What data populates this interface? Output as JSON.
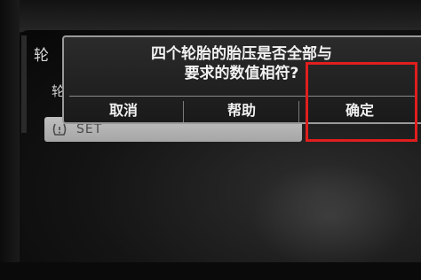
{
  "background_menu": {
    "title": "轮",
    "item": "轮",
    "set_row": {
      "icon": "tire-pressure-icon",
      "label": "SET"
    }
  },
  "dialog": {
    "message_line1": "四个轮胎的胎压是否全部与",
    "message_line2": "要求的数值相符?",
    "buttons": {
      "cancel": "取消",
      "help": "帮助",
      "confirm": "确定"
    }
  },
  "annotation": {
    "highlight_color": "#e11e1e",
    "highlighted": "confirm"
  }
}
